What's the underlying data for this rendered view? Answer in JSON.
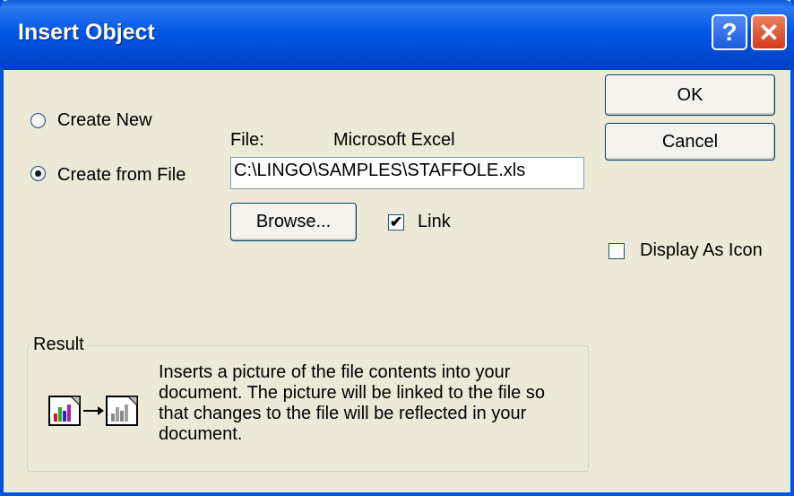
{
  "window": {
    "title": "Insert Object"
  },
  "title_buttons": {
    "help": "?",
    "close": "✕"
  },
  "options": {
    "create_new": "Create New",
    "create_from_file": "Create from File",
    "selected": "create_from_file"
  },
  "file": {
    "label": "File:",
    "type": "Microsoft Excel",
    "path": "C:\\LINGO\\SAMPLES\\STAFFOLE.xls"
  },
  "buttons": {
    "ok": "OK",
    "cancel": "Cancel",
    "browse": "Browse..."
  },
  "link": {
    "label": "Link",
    "checked": true,
    "mark": "✔"
  },
  "display_as_icon": {
    "label": "Display As Icon",
    "checked": false
  },
  "result": {
    "title": "Result",
    "text": "Inserts a picture of the file contents into your document.  The picture will be linked to the file so that changes to the file will be reflected in your document.",
    "icon": "linked-picture-icon"
  }
}
